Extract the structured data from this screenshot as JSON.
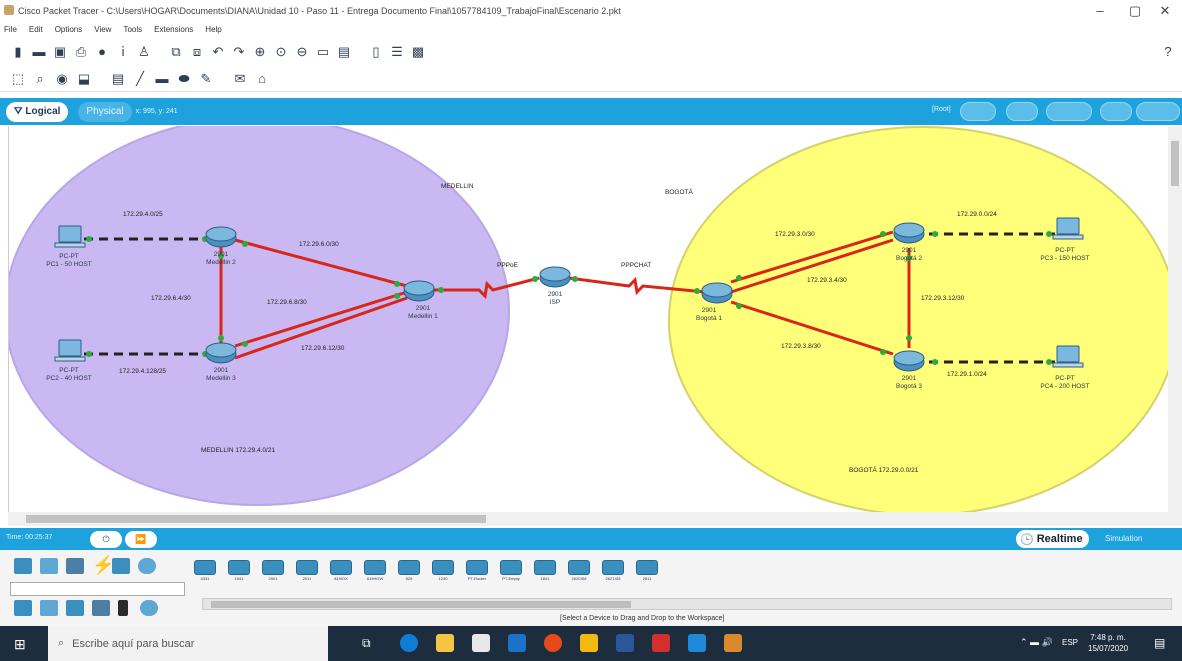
{
  "window": {
    "title": "Cisco Packet Tracer - C:\\Users\\HOGAR\\Documents\\DIANA\\Unidad 10 - Paso 11 - Entrega Documento Final\\1057784109_TrabajoFinal\\Escenario 2.pkt",
    "minimize": "–",
    "maximize": "▢",
    "close": "✕"
  },
  "menu": [
    "File",
    "Edit",
    "Options",
    "View",
    "Tools",
    "Extensions",
    "Help"
  ],
  "toolbar": {
    "help": "?"
  },
  "views": {
    "logical": "Logical",
    "physical": "Physical",
    "coords": "x: 995, y: 241",
    "root": "[Root]"
  },
  "zones": {
    "medellin_title": "MEDELLIN",
    "medellin_net": "MEDELLIN 172.29.4.0/21",
    "bogota_title": "BOGOTÁ",
    "bogota_net": "BOGOTÁ 172.29.0.0/21"
  },
  "devices": {
    "med1": {
      "model": "2901",
      "name": "Medellin 1"
    },
    "med2": {
      "model": "2901",
      "name": "Medellin 2"
    },
    "med3": {
      "model": "2901",
      "name": "Medellin 3"
    },
    "isp": {
      "model": "2901",
      "name": "ISP"
    },
    "bog1": {
      "model": "2901",
      "name": "Bogotá 1"
    },
    "bog2": {
      "model": "2901",
      "name": "Bogotá 2"
    },
    "bog3": {
      "model": "2901",
      "name": "Bogotá 3"
    },
    "pc1": {
      "model": "PC-PT",
      "name": "PC1 - 50 HOST"
    },
    "pc2": {
      "model": "PC-PT",
      "name": "PC2 - 40 HOST"
    },
    "pc3": {
      "model": "PC-PT",
      "name": "PC3 - 150 HOST"
    },
    "pc4": {
      "model": "PC-PT",
      "name": "PC4 - 200 HOST"
    }
  },
  "links": {
    "pc1_med2": "172.29.4.0/25",
    "pc2_med3": "172.29.4.128/25",
    "med2_med3": "172.29.6.4/30",
    "med2_med1": "172.29.6.0/30",
    "med3_med1_a": "172.29.6.8/30",
    "med3_med1_b": "172.29.6.12/30",
    "isp_left": "PPPoE",
    "isp_right": "PPPCHAT",
    "bog1_bog2_a": "172.29.3.0/30",
    "bog1_bog2_b": "172.29.3.4/30",
    "bog2_bog3": "172.29.3.12/30",
    "bog1_bog3": "172.29.3.8/30",
    "bog2_pc3": "172.29.0.0/24",
    "bog3_pc4": "172.29.1.0/24"
  },
  "status": {
    "time": "Time: 00:25:37",
    "realtime": "Realtime",
    "simulation": "Simulation"
  },
  "device_list": [
    "4331",
    "1941",
    "2901",
    "2911",
    "819IOX",
    "819HGW",
    "829",
    "1240",
    "PT-Router",
    "PT-Empty",
    "1841",
    "2620XM",
    "2621XM",
    "2811"
  ],
  "device_hint": "[Select a Device to Drag and Drop to the Workspace]",
  "taskbar": {
    "search_placeholder": "Escribe aquí para buscar",
    "lang": "ESP",
    "time": "7:48 p. m.",
    "date": "15/07/2020"
  }
}
